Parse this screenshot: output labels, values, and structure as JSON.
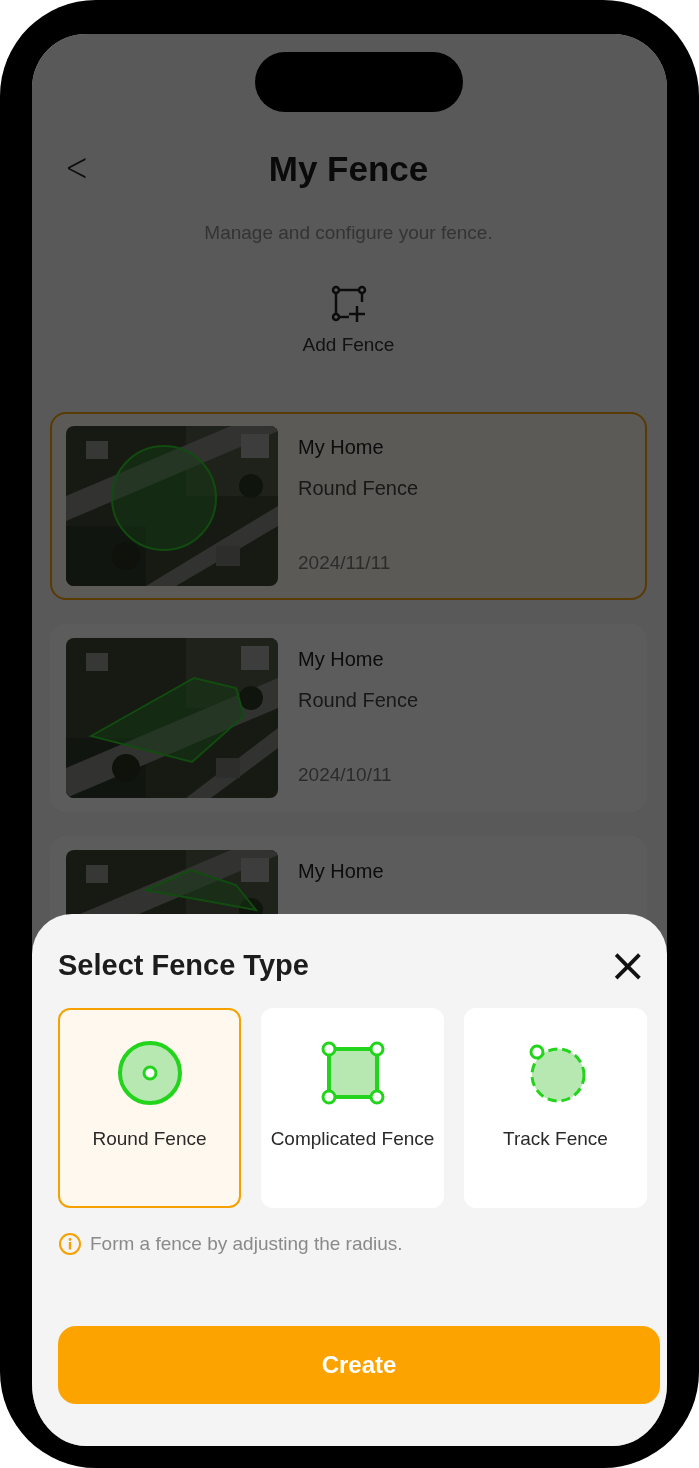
{
  "header": {
    "back": "<",
    "title": "My Fence",
    "subtitle": "Manage and configure your fence.",
    "add_label": "Add Fence"
  },
  "fences": [
    {
      "name": "My Home",
      "type": "Round Fence",
      "date": "2024/11/11",
      "selected": true,
      "kind": "picture"
    },
    {
      "name": "My Home",
      "type": "Round Fence",
      "date": "2024/10/11",
      "selected": false,
      "kind": "picture"
    },
    {
      "name": "My Home",
      "selected": false,
      "kind": "picture"
    }
  ],
  "sheet": {
    "title": "Select Fence Type",
    "close": "×",
    "options": [
      {
        "kind": "round",
        "label": "Round Fence",
        "selected": true
      },
      {
        "kind": "complicated",
        "label": "Complicated Fence",
        "selected": false
      },
      {
        "kind": "track",
        "label": "Track Fence",
        "selected": false
      }
    ],
    "hint": "Form a fence by adjusting the radius.",
    "button": "Create"
  }
}
